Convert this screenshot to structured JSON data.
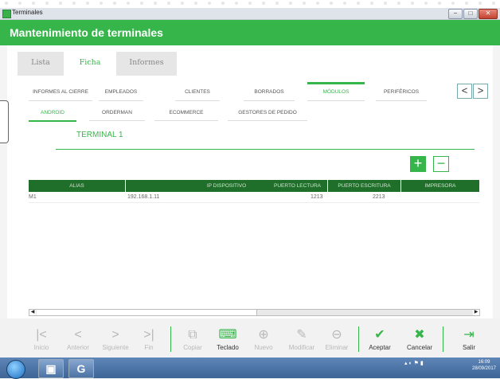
{
  "window": {
    "title": "Terminales"
  },
  "header": {
    "title": "Mantenimiento de terminales"
  },
  "outer_tabs": [
    {
      "label": "Lista",
      "active": false
    },
    {
      "label": "Ficha",
      "active": true
    },
    {
      "label": "Informes",
      "active": false
    }
  ],
  "module_tabs": [
    {
      "label": "INFORMES AL CIERRE",
      "active": false
    },
    {
      "label": "EMPLEADOS",
      "active": false
    },
    {
      "label": "CLIENTES",
      "active": false
    },
    {
      "label": "BORRADOS",
      "active": false
    },
    {
      "label": "MÓDULOS",
      "active": true
    },
    {
      "label": "PERIFÉRICOS",
      "active": false
    }
  ],
  "nav": {
    "prev": "<",
    "next": ">"
  },
  "sub_tabs": [
    {
      "label": "ANDROID",
      "active": true
    },
    {
      "label": "ORDERMAN",
      "active": false
    },
    {
      "label": "ECOMMERCE",
      "active": false
    },
    {
      "label": "GESTORES DE PEDIDO",
      "active": false
    }
  ],
  "terminal": {
    "label": "TERMINAL 1"
  },
  "actions": {
    "add": "+",
    "remove": "−"
  },
  "grid": {
    "columns": [
      "ALIAS",
      "IP DISPOSITIVO",
      "PUERTO LECTURA",
      "PUERTO ESCRITURA",
      "IMPRESORA"
    ],
    "rows": [
      {
        "alias": "M1",
        "ip": "192.168.1.11",
        "puerto_lectura": "1213",
        "puerto_escritura": "2213",
        "impresora": ""
      }
    ]
  },
  "scroll": {
    "left": "◀",
    "right": "▶"
  },
  "toolbar": [
    {
      "label": "Inicio",
      "icon": "|<",
      "enabled": false
    },
    {
      "label": "Anterior",
      "icon": "<",
      "enabled": false
    },
    {
      "label": "Siguiente",
      "icon": ">",
      "enabled": false
    },
    {
      "label": "Fin",
      "icon": ">|",
      "enabled": false
    },
    {
      "label": "Copiar",
      "icon": "⧉",
      "enabled": false
    },
    {
      "label": "Teclado",
      "icon": "⌨",
      "enabled": true
    },
    {
      "label": "Nuevo",
      "icon": "⊕",
      "enabled": false
    },
    {
      "label": "Modificar",
      "icon": "✎",
      "enabled": false
    },
    {
      "label": "Eliminar",
      "icon": "⊖",
      "enabled": false
    },
    {
      "label": "Aceptar",
      "icon": "✔",
      "enabled": true
    },
    {
      "label": "Cancelar",
      "icon": "✖",
      "enabled": true
    },
    {
      "label": "Salir",
      "icon": "⇥",
      "enabled": true
    }
  ],
  "taskbar": {
    "apps": [
      "G"
    ],
    "clock_time": "16:09",
    "clock_date": "28/09/2017"
  },
  "colors": {
    "accent": "#36b54a",
    "grid_header": "#1f6e2a"
  }
}
